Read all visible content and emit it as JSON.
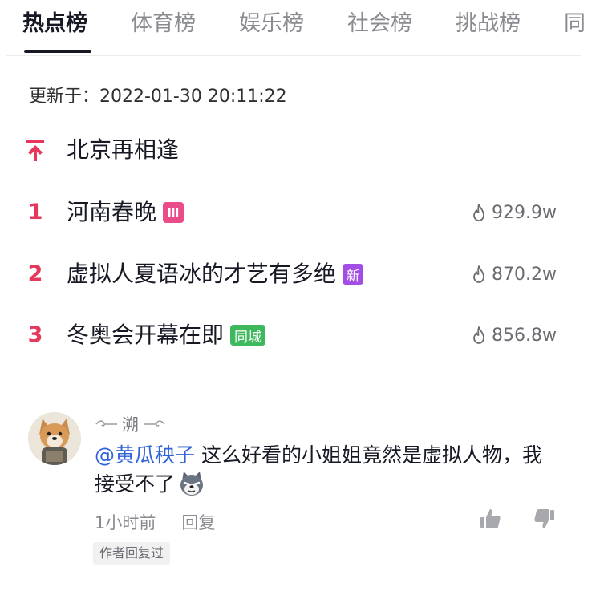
{
  "tabs": [
    {
      "label": "热点榜"
    },
    {
      "label": "体育榜"
    },
    {
      "label": "娱乐榜"
    },
    {
      "label": "社会榜"
    },
    {
      "label": "挑战榜"
    },
    {
      "label": "同"
    }
  ],
  "updated_text": "更新于：2022-01-30 20:11:22",
  "pinned": {
    "title": "北京再相逢",
    "icon": "pin-top-icon"
  },
  "items": [
    {
      "rank": "1",
      "title": "河南春晚",
      "badge": "",
      "badge_icon": "hot-bars-icon",
      "heat": "929.9w"
    },
    {
      "rank": "2",
      "title": "虚拟人夏语冰的才艺有多绝",
      "badge": "新",
      "heat": "870.2w"
    },
    {
      "rank": "3",
      "title": "冬奥会开幕在即",
      "badge": "同城",
      "heat": "856.8w"
    }
  ],
  "comment": {
    "username": "溯",
    "mention": "@黄瓜秧子",
    "text": " 这么好看的小姐姐竟然是虚拟人物，我接受不了",
    "time": "1小时前",
    "reply_label": "回复",
    "author_tag": "作者回复过",
    "emoji": "wolf-face-icon"
  },
  "colors": {
    "rank": "#e5385c",
    "mention": "#2f62d8",
    "badge_hot": "#ea4c89",
    "badge_new": "#a14de6",
    "badge_city": "#3db85d"
  }
}
